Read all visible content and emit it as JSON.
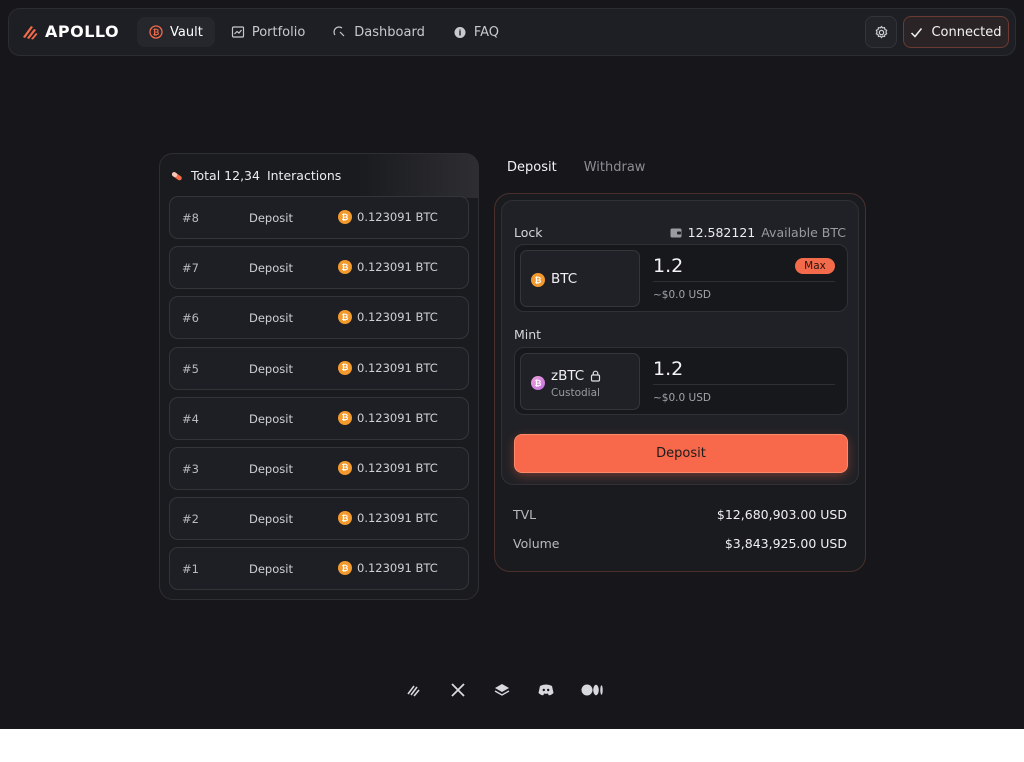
{
  "brand": {
    "name": "APOLLO",
    "accent": "#f36b4a"
  },
  "nav": {
    "links": [
      {
        "label": "Vault",
        "icon": "bitcoin-icon",
        "active": true
      },
      {
        "label": "Portfolio",
        "icon": "chart-icon",
        "active": false
      },
      {
        "label": "Dashboard",
        "icon": "gauge-icon",
        "active": false
      },
      {
        "label": "FAQ",
        "icon": "help-icon",
        "active": false
      }
    ],
    "settings_icon": "gear-icon",
    "connected_label": "Connected"
  },
  "interactions": {
    "header": "Total 12,34",
    "header_suffix": "Interactions",
    "rows": [
      {
        "id": "#8",
        "type": "Deposit",
        "amount": "0.123091 BTC"
      },
      {
        "id": "#7",
        "type": "Deposit",
        "amount": "0.123091 BTC"
      },
      {
        "id": "#6",
        "type": "Deposit",
        "amount": "0.123091 BTC"
      },
      {
        "id": "#5",
        "type": "Deposit",
        "amount": "0.123091 BTC"
      },
      {
        "id": "#4",
        "type": "Deposit",
        "amount": "0.123091 BTC"
      },
      {
        "id": "#3",
        "type": "Deposit",
        "amount": "0.123091 BTC"
      },
      {
        "id": "#2",
        "type": "Deposit",
        "amount": "0.123091 BTC"
      },
      {
        "id": "#1",
        "type": "Deposit",
        "amount": "0.123091 BTC"
      }
    ]
  },
  "tabs": {
    "deposit": "Deposit",
    "withdraw": "Withdraw"
  },
  "vault": {
    "lock_label": "Lock",
    "available_amount": "12.582121",
    "available_unit": "Available BTC",
    "lock_asset": "BTC",
    "lock_amount": "1.2",
    "lock_usd": "~$0.0 USD",
    "max_label": "Max",
    "mint_label": "Mint",
    "mint_asset": "zBTC",
    "mint_asset_sub": "Custodial",
    "mint_amount": "1.2",
    "mint_usd": "~$0.0 USD",
    "deposit_button": "Deposit"
  },
  "stats": {
    "tvl_label": "TVL",
    "tvl_value": "$12,680,903.00 USD",
    "volume_label": "Volume",
    "volume_value": "$3,843,925.00 USD"
  },
  "footer": {
    "icons": [
      "apollo-icon",
      "x-icon",
      "layers-icon",
      "discord-icon",
      "medium-icon"
    ]
  }
}
